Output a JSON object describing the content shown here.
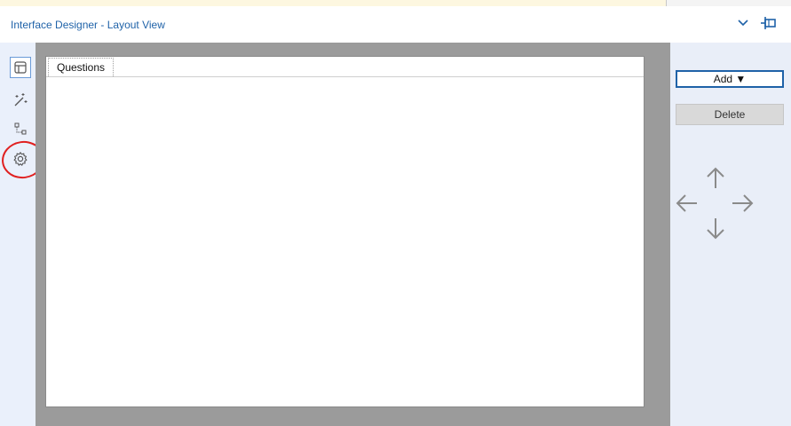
{
  "window": {
    "title": "Interface Designer - Layout View",
    "collapse_icon": "chevron-down-icon",
    "pin_icon": "pin-icon"
  },
  "left_rail": {
    "items": [
      {
        "name": "layout-view",
        "icon": "layout-icon",
        "active": true
      },
      {
        "name": "actions",
        "icon": "magic-wand-icon",
        "active": false
      },
      {
        "name": "tree",
        "icon": "tree-icon",
        "active": false
      },
      {
        "name": "properties",
        "icon": "gear-icon",
        "active": false,
        "highlighted": true
      }
    ]
  },
  "canvas": {
    "tab_label": "Questions"
  },
  "right_panel": {
    "add_label": "Add ▼",
    "delete_label": "Delete",
    "arrow_icons": [
      "arrow-up-icon",
      "arrow-left-icon",
      "arrow-right-icon",
      "arrow-down-icon"
    ]
  },
  "colors": {
    "accent": "#1f62a8",
    "rail_bg": "#eaf0fb",
    "canvas_bg": "#9b9b9b",
    "highlight": "#e02020"
  }
}
